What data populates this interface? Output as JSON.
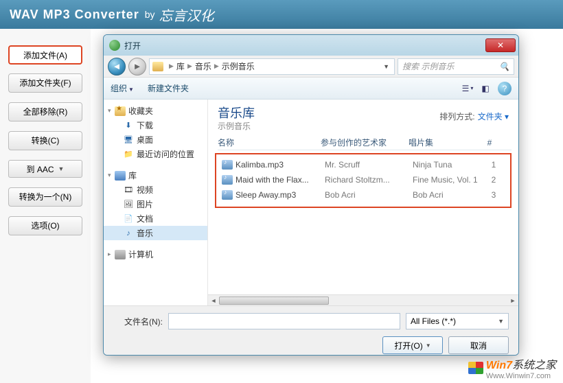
{
  "app": {
    "title": "WAV MP3 Converter",
    "by": "by",
    "brand": "忘言汉化"
  },
  "sidebar": {
    "add_file": "添加文件(A)",
    "add_folder": "添加文件夹(F)",
    "remove_all": "全部移除(R)",
    "convert": "转换(C)",
    "to_fmt": "到 AAC",
    "convert_one": "转换为一个(N)",
    "options": "选项(O)"
  },
  "dialog": {
    "title": "打开",
    "breadcrumb": [
      "库",
      "音乐",
      "示例音乐"
    ],
    "search_placeholder": "搜索 示例音乐",
    "toolbar": {
      "organize": "组织",
      "new_folder": "新建文件夹"
    },
    "tree": {
      "fav": "收藏夹",
      "fav_items": [
        "下载",
        "桌面",
        "最近访问的位置"
      ],
      "lib": "库",
      "lib_items": [
        "视频",
        "图片",
        "文档",
        "音乐"
      ],
      "computer": "计算机"
    },
    "list": {
      "title": "音乐库",
      "subtitle": "示例音乐",
      "sort_label": "排列方式:",
      "sort_value": "文件夹",
      "cols": [
        "名称",
        "参与创作的艺术家",
        "唱片集",
        "#"
      ],
      "rows": [
        {
          "name": "Kalimba.mp3",
          "artist": "Mr. Scruff",
          "album": "Ninja Tuna",
          "track": "1"
        },
        {
          "name": "Maid with the Flax...",
          "artist": "Richard Stoltzm...",
          "album": "Fine Music, Vol. 1",
          "track": "2"
        },
        {
          "name": "Sleep Away.mp3",
          "artist": "Bob Acri",
          "album": "Bob Acri",
          "track": "3"
        }
      ]
    },
    "footer": {
      "filename_label": "文件名(N):",
      "filter": "All Files (*.*)",
      "open": "打开(O)",
      "cancel": "取消"
    }
  },
  "watermark": {
    "brand_a": "Win7",
    "brand_b": "系统之家",
    "url": "Www.Winwin7.com"
  }
}
